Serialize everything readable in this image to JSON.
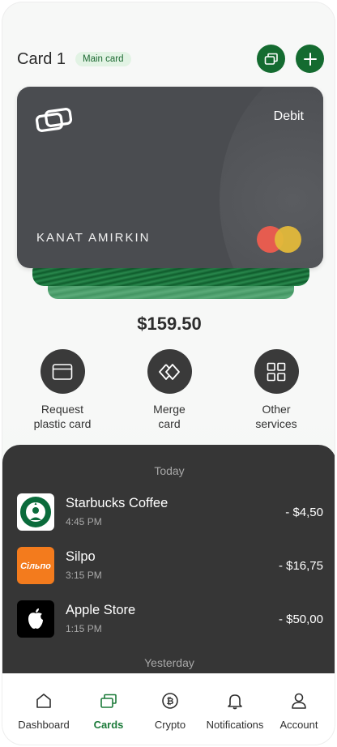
{
  "header": {
    "title": "Card 1",
    "badge": "Main card"
  },
  "card": {
    "type": "Debit",
    "holder": "KANAT AMIRKIN",
    "network_icon": "mastercard-logo",
    "colors": {
      "card_bg": "#4a4c50",
      "accent": "#146b30"
    }
  },
  "balance": "$159.50",
  "actions": [
    {
      "label": "Request\nplastic card",
      "icon": "card-icon"
    },
    {
      "label": "Merge\ncard",
      "icon": "merge-icon"
    },
    {
      "label": "Other\nservices",
      "icon": "grid-icon"
    }
  ],
  "transactions": {
    "today_label": "Today",
    "yesterday_label": "Yesterday",
    "items": [
      {
        "name": "Starbucks Coffee",
        "time": "4:45 PM",
        "amount": "- $4,50",
        "icon": "starbucks-logo"
      },
      {
        "name": "Silpo",
        "time": "3:15 PM",
        "amount": "- $16,75",
        "icon": "silpo-logo"
      },
      {
        "name": "Apple Store",
        "time": "1:15 PM",
        "amount": "- $50,00",
        "icon": "apple-logo"
      }
    ]
  },
  "nav": {
    "items": [
      {
        "label": "Dashboard",
        "icon": "home-icon"
      },
      {
        "label": "Cards",
        "icon": "cards-icon",
        "active": true
      },
      {
        "label": "Crypto",
        "icon": "bitcoin-icon"
      },
      {
        "label": "Notifications",
        "icon": "bell-icon"
      },
      {
        "label": "Account",
        "icon": "user-icon"
      }
    ]
  }
}
